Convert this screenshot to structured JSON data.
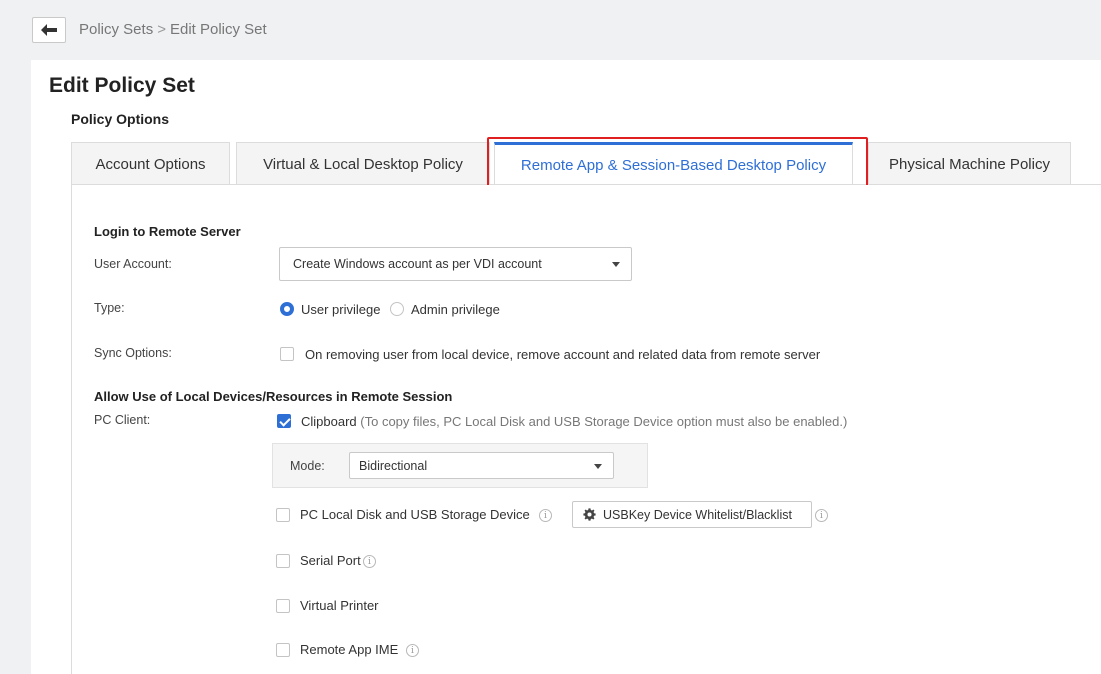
{
  "breadcrumb": {
    "parent": "Policy Sets",
    "separator": ">",
    "current": "Edit Policy Set"
  },
  "page": {
    "title": "Edit Policy Set",
    "section": "Policy Options"
  },
  "tabs": [
    {
      "label": "Account Options"
    },
    {
      "label": "Virtual & Local Desktop Policy"
    },
    {
      "label": "Remote App & Session-Based Desktop Policy"
    },
    {
      "label": "Physical Machine Policy"
    }
  ],
  "active_tab": "Remote App & Session-Based Desktop Policy",
  "login": {
    "heading": "Login to Remote Server",
    "user_account_label": "User Account:",
    "user_account_value": "Create Windows account as per VDI account",
    "type_label": "Type:",
    "type_options": [
      "User privilege",
      "Admin privilege"
    ],
    "type_selected": "User privilege",
    "sync_label": "Sync Options:",
    "sync_option": "On removing user from local device, remove account and related data from remote server",
    "sync_checked": false
  },
  "local_devices": {
    "heading": "Allow Use of Local Devices/Resources in Remote Session",
    "pc_client_label": "PC Client:",
    "clipboard_label": "Clipboard",
    "clipboard_hint": "(To copy files, PC Local Disk and USB Storage Device option must also be enabled.)",
    "clipboard_checked": true,
    "mode_label": "Mode:",
    "mode_value": "Bidirectional",
    "local_disk_label": "PC Local Disk and USB Storage Device",
    "local_disk_checked": false,
    "usbkey_button": "USBKey Device Whitelist/Blacklist",
    "serial_port_label": "Serial Port",
    "virtual_printer_label": "Virtual Printer",
    "remote_ime_label": "Remote App IME"
  },
  "icons": {
    "back": "arrow-left-icon",
    "info": "info-icon",
    "gear": "gear-icon",
    "caret": "caret-down-icon"
  },
  "colors": {
    "accent": "#2e6fd6",
    "highlight": "#e02020"
  }
}
